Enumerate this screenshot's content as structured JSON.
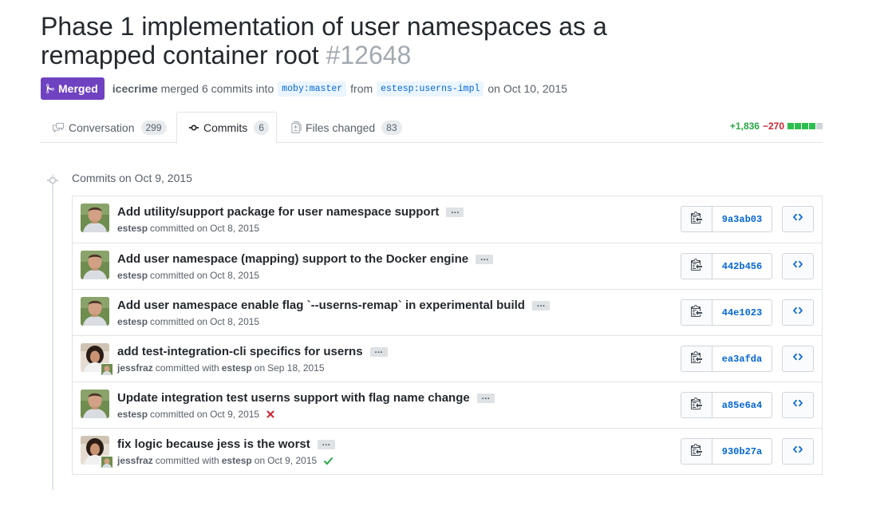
{
  "pr": {
    "title": "Phase 1 implementation of user namespaces as a remapped container root",
    "number": "#12648",
    "state": "Merged",
    "author": "icecrime",
    "merged_text": "merged 6 commits into",
    "base_branch": "moby:master",
    "from_text": "from",
    "head_branch": "estesp:userns-impl",
    "date_text": "on Oct 10, 2015"
  },
  "tabs": [
    {
      "label": "Conversation",
      "count": "299",
      "icon": "comment-discussion-icon"
    },
    {
      "label": "Commits",
      "count": "6",
      "icon": "commit-icon"
    },
    {
      "label": "Files changed",
      "count": "83",
      "icon": "file-diff-icon"
    }
  ],
  "diffstat": {
    "additions": "+1,836",
    "deletions": "−270",
    "blocks": [
      "green",
      "green",
      "green",
      "green",
      "gray"
    ]
  },
  "colors": {
    "merged": "#6f42c1",
    "link": "#0366d6",
    "add": "#28a745",
    "del": "#cb2431"
  },
  "commits_header": "Commits on Oct 9, 2015",
  "commits": [
    {
      "message": "Add utility/support package for user namespace support",
      "author": "estesp",
      "verb": "committed on",
      "coauthor": "",
      "with_text": "",
      "date": "Oct 8, 2015",
      "sha": "9a3ab03",
      "status": "",
      "avatar": "estesp"
    },
    {
      "message": "Add user namespace (mapping) support to the Docker engine",
      "author": "estesp",
      "verb": "committed on",
      "coauthor": "",
      "with_text": "",
      "date": "Oct 8, 2015",
      "sha": "442b456",
      "status": "",
      "avatar": "estesp"
    },
    {
      "message": "Add user namespace enable flag `--userns-remap` in experimental build",
      "author": "estesp",
      "verb": "committed on",
      "coauthor": "",
      "with_text": "",
      "date": "Oct 8, 2015",
      "sha": "44e1023",
      "status": "",
      "avatar": "estesp"
    },
    {
      "message": "add test-integration-cli specifics for userns",
      "author": "jessfraz",
      "verb": "committed with",
      "coauthor": "estesp",
      "with_text": "on",
      "date": "Sep 18, 2015",
      "sha": "ea3afda",
      "status": "",
      "avatar": "jessfraz"
    },
    {
      "message": "Update integration test userns support with flag name change",
      "author": "estesp",
      "verb": "committed on",
      "coauthor": "",
      "with_text": "",
      "date": "Oct 9, 2015",
      "sha": "a85e6a4",
      "status": "failure",
      "avatar": "estesp"
    },
    {
      "message": "fix logic because jess is the worst",
      "author": "jessfraz",
      "verb": "committed with",
      "coauthor": "estesp",
      "with_text": "on",
      "date": "Oct 9, 2015",
      "sha": "930b27a",
      "status": "success",
      "avatar": "jessfraz"
    }
  ]
}
